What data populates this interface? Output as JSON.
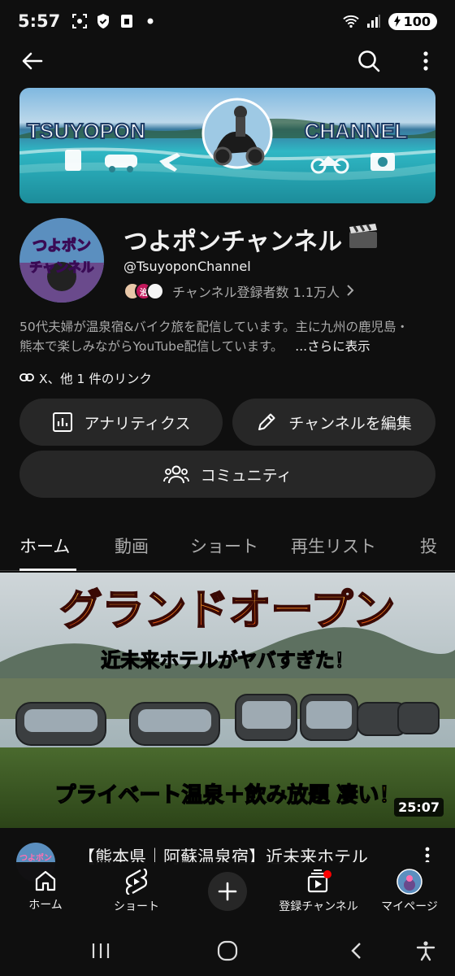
{
  "status_bar": {
    "time": "5:57",
    "battery": "100",
    "icons": [
      "screenshot-icon",
      "shield-check-icon",
      "sim-icon",
      "dot-icon",
      "wifi-icon",
      "signal-icon"
    ]
  },
  "banner": {
    "left_text": "TSUYOPON",
    "right_text": "CHANNEL"
  },
  "channel": {
    "avatar_text_top": "つよポン",
    "avatar_text_bottom": "チャンネル",
    "name": "つよポンチャンネル",
    "handle": "@TsuyoponChannel",
    "mini_avatar_label": "治",
    "subscribers": "チャンネル登録者数 1.1万人",
    "description_line1": "50代夫婦が温泉宿&バイク旅を配信しています。主に九州の鹿児島・",
    "description_line2": "熊本で楽しみながらYouTube配信しています。",
    "more_label": "...さらに表示",
    "links_text": "X、他 1 件のリンク"
  },
  "actions": {
    "analytics": "アナリティクス",
    "edit_channel": "チャンネルを編集",
    "community": "コミュニティ"
  },
  "tabs": [
    "ホーム",
    "動画",
    "ショート",
    "再生リスト",
    "投"
  ],
  "active_tab": "ホーム",
  "featured_video": {
    "thumb_title": "グランドオープン",
    "thumb_sub": "近未来ホテルがヤバすぎた！",
    "thumb_bottom": "プライベート温泉＋飲み放題 凄い！",
    "duration": "25:07",
    "title": "【熊本県｜阿蘇温泉宿】近未来ホテル",
    "channel_avatar_text": "つよポン"
  },
  "bottom_nav": {
    "home": "ホーム",
    "shorts": "ショート",
    "subscriptions": "登録チャンネル",
    "mypage": "マイページ"
  },
  "colors": {
    "background": "#0f0f0f",
    "pill": "#272727",
    "secondary_text": "#aaaaaa",
    "accent_red": "#ff0000"
  }
}
